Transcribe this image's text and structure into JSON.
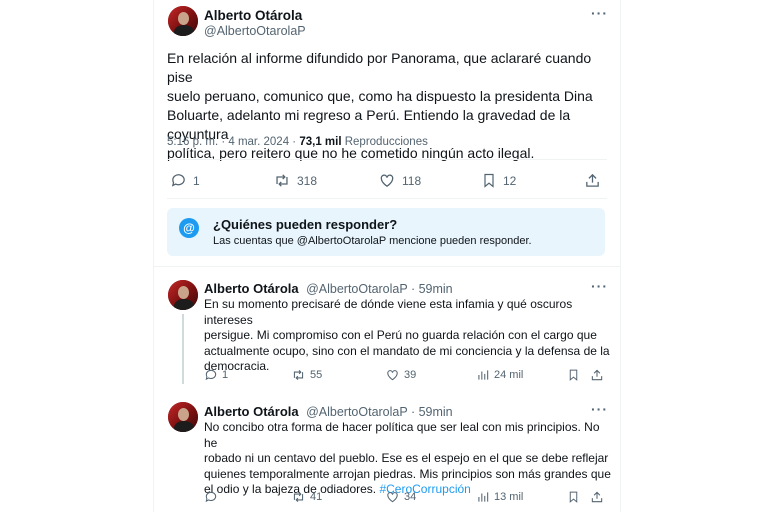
{
  "main_tweet": {
    "author_name": "Alberto Otárola",
    "author_handle": "@AlbertoOtarolaP",
    "text_lines": [
      "En relación al informe difundido por Panorama, que aclararé cuando pise",
      "suelo peruano, comunico que, como ha dispuesto la presidenta Dina",
      "Boluarte, adelanto mi regreso a Perú. Entiendo la gravedad de la coyuntura",
      "política, pero reitero que no he cometido ningún acto ilegal."
    ],
    "time": "5:16 p. m. · 4 mar. 2024 ·",
    "views_count": "73,1 mil",
    "views_label": "Reproducciones",
    "replies": "1",
    "retweets": "318",
    "likes": "118",
    "bookmarks": "12"
  },
  "reply_notice": {
    "icon": "at-icon",
    "title": "¿Quiénes pueden responder?",
    "subtitle": "Las cuentas que @AlbertoOtarolaP mencione pueden responder."
  },
  "replies": [
    {
      "author_name": "Alberto Otárola",
      "author_handle": "@AlbertoOtarolaP · 59min",
      "text_lines": [
        "En su momento precisaré de dónde viene esta infamia y qué oscuros intereses",
        "persigue. Mi compromiso con el Perú no guarda relación con el cargo que",
        "actualmente ocupo, sino con el mandato de mi conciencia y la defensa de la",
        "democracia."
      ],
      "hashtag": "",
      "replies": "1",
      "retweets": "55",
      "likes": "39",
      "views": "24 mil"
    },
    {
      "author_name": "Alberto Otárola",
      "author_handle": "@AlbertoOtarolaP · 59min",
      "text_lines": [
        "No concibo otra forma de hacer política que ser leal con mis principios. No he",
        "robado ni un centavo del pueblo. Ese es el espejo en el que se debe reflejar",
        "quienes temporalmente arrojan piedras. Mis principios son más grandes que",
        "el odio y la bajeza de odiadores. "
      ],
      "hashtag": "#CeroCorrupción",
      "replies": "",
      "retweets": "41",
      "likes": "34",
      "views": "13 mil"
    }
  ],
  "colors": {
    "accent": "#1d9bf0",
    "notice_bg": "#e8f5fd",
    "secondary_text": "#536471"
  }
}
